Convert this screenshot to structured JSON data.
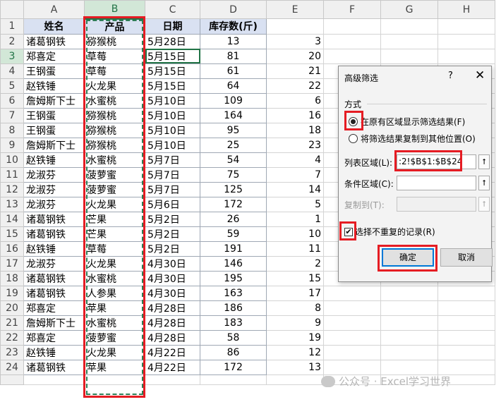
{
  "columns": [
    "A",
    "B",
    "C",
    "D",
    "E",
    "F",
    "G",
    "H"
  ],
  "header_row": {
    "row": "1",
    "name": "姓名",
    "product": "产品",
    "date": "日期",
    "stock": "库存数(斤)"
  },
  "rows": [
    {
      "row": "2",
      "name": "诸葛钢铁",
      "product": "猕猴桃",
      "date": "5月28日",
      "stock": "13",
      "e": "3"
    },
    {
      "row": "3",
      "name": "郑喜定",
      "product": "草莓",
      "date": "5月15日",
      "stock": "81",
      "e": "20"
    },
    {
      "row": "4",
      "name": "王钢蛋",
      "product": "草莓",
      "date": "5月15日",
      "stock": "61",
      "e": "21"
    },
    {
      "row": "5",
      "name": "赵铁锤",
      "product": "火龙果",
      "date": "5月15日",
      "stock": "64",
      "e": "22"
    },
    {
      "row": "6",
      "name": "詹姆斯下士",
      "product": "水蜜桃",
      "date": "5月10日",
      "stock": "109",
      "e": "6"
    },
    {
      "row": "7",
      "name": "王钢蛋",
      "product": "猕猴桃",
      "date": "5月10日",
      "stock": "164",
      "e": "16"
    },
    {
      "row": "8",
      "name": "王钢蛋",
      "product": "猕猴桃",
      "date": "5月10日",
      "stock": "95",
      "e": "18"
    },
    {
      "row": "9",
      "name": "詹姆斯下士",
      "product": "猕猴桃",
      "date": "5月10日",
      "stock": "25",
      "e": "23"
    },
    {
      "row": "10",
      "name": "赵铁锤",
      "product": "水蜜桃",
      "date": "5月7日",
      "stock": "54",
      "e": "4"
    },
    {
      "row": "11",
      "name": "龙淑芬",
      "product": "菠萝蜜",
      "date": "5月7日",
      "stock": "75",
      "e": "7"
    },
    {
      "row": "12",
      "name": "龙淑芬",
      "product": "菠萝蜜",
      "date": "5月7日",
      "stock": "125",
      "e": "14"
    },
    {
      "row": "13",
      "name": "龙淑芬",
      "product": "火龙果",
      "date": "5月6日",
      "stock": "172",
      "e": "5"
    },
    {
      "row": "14",
      "name": "诸葛钢铁",
      "product": "芒果",
      "date": "5月2日",
      "stock": "26",
      "e": "1"
    },
    {
      "row": "15",
      "name": "诸葛钢铁",
      "product": "芒果",
      "date": "5月2日",
      "stock": "59",
      "e": "10"
    },
    {
      "row": "16",
      "name": "赵铁锤",
      "product": "草莓",
      "date": "5月2日",
      "stock": "191",
      "e": "11"
    },
    {
      "row": "17",
      "name": "龙淑芬",
      "product": "火龙果",
      "date": "4月30日",
      "stock": "146",
      "e": "2"
    },
    {
      "row": "18",
      "name": "诸葛钢铁",
      "product": "水蜜桃",
      "date": "4月30日",
      "stock": "195",
      "e": "15"
    },
    {
      "row": "19",
      "name": "诸葛钢铁",
      "product": "人参果",
      "date": "4月30日",
      "stock": "163",
      "e": "17"
    },
    {
      "row": "20",
      "name": "郑喜定",
      "product": "苹果",
      "date": "4月28日",
      "stock": "186",
      "e": "8"
    },
    {
      "row": "21",
      "name": "詹姆斯下士",
      "product": "水蜜桃",
      "date": "4月28日",
      "stock": "183",
      "e": "9"
    },
    {
      "row": "22",
      "name": "郑喜定",
      "product": "菠萝蜜",
      "date": "4月28日",
      "stock": "58",
      "e": "19"
    },
    {
      "row": "23",
      "name": "赵铁锤",
      "product": "火龙果",
      "date": "4月22日",
      "stock": "86",
      "e": "12"
    },
    {
      "row": "24",
      "name": "诸葛钢铁",
      "product": "苹果",
      "date": "4月22日",
      "stock": "172",
      "e": "13"
    }
  ],
  "dialog": {
    "title": "高级筛选",
    "help": "?",
    "close": "✕",
    "method_label": "方式",
    "option_in_place": "在原有区域显示筛选结果(F)",
    "option_copy": "将筛选结果复制到其他位置(O)",
    "list_range_label": "列表区域(L):",
    "list_range_value": ":2!$B$1:$B$24",
    "criteria_label": "条件区域(C):",
    "criteria_value": "",
    "copy_to_label": "复制到(T):",
    "copy_to_value": "",
    "unique_label": "选择不重复的记录(R)",
    "ok": "确定",
    "cancel": "取消"
  },
  "icons": {
    "range_picker": "collapse-dialog-icon",
    "check": "✔",
    "pick_glyph": "⭡"
  },
  "colors": {
    "annotation": "#e51c23",
    "header_fill": "#d9e1f2",
    "excel_green": "#217346",
    "ok_border": "#0078d7"
  },
  "watermark": "公众号 · Excel学习世界"
}
